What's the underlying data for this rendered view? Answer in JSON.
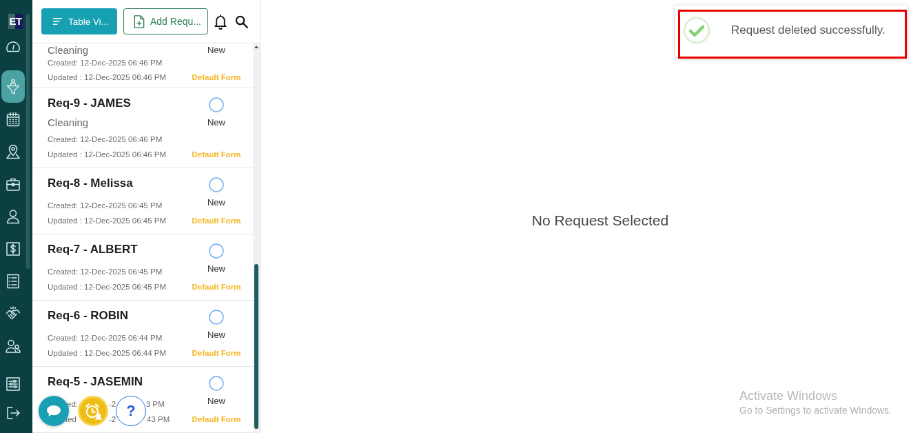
{
  "sidebar": {
    "logo": "ET",
    "items": [
      {
        "selected": false
      },
      {
        "selected": true
      },
      {
        "selected": false
      },
      {
        "selected": false
      },
      {
        "selected": false
      },
      {
        "selected": false
      },
      {
        "selected": false
      },
      {
        "selected": false
      },
      {
        "selected": false
      },
      {
        "selected": false
      }
    ],
    "bottom_items": [
      {
        "selected": false
      },
      {
        "selected": false
      }
    ]
  },
  "toolbar": {
    "view_button": "Table Vi...",
    "add_button": "Add Requ..."
  },
  "requests": [
    {
      "subtitle": "Cleaning",
      "status": "New",
      "created": "Created: 12-Dec-2025 06:46 PM",
      "updated": "Updated : 12-Dec-2025 06:46 PM",
      "form": "Default Form"
    },
    {
      "title": "Req-9 - JAMES",
      "subtitle": "Cleaning",
      "status": "New",
      "created": "Created: 12-Dec-2025 06:46 PM",
      "updated": "Updated : 12-Dec-2025 06:46 PM",
      "form": "Default Form"
    },
    {
      "title": "Req-8 - Melissa",
      "status": "New",
      "created": "Created: 12-Dec-2025 06:45 PM",
      "updated": "Updated : 12-Dec-2025 06:45 PM",
      "form": "Default Form"
    },
    {
      "title": "Req-7 - ALBERT",
      "status": "New",
      "created": "Created: 12-Dec-2025 06:45 PM",
      "updated": "Updated : 12-Dec-2025 06:45 PM",
      "form": "Default Form"
    },
    {
      "title": "Req-6 - ROBIN",
      "status": "New",
      "created": "Created: 12-Dec-2025 06:44 PM",
      "updated": "Updated : 12-Dec-2025 06:44 PM",
      "form": "Default Form"
    },
    {
      "title": "Req-5 - JASEMIN",
      "status": "New",
      "created_fragments": [
        "ed:",
        "-2",
        "3 PM"
      ],
      "updated_fragments": [
        "ted",
        "-2",
        "43 PM"
      ],
      "form": "Default Form"
    }
  ],
  "floating_buttons": {
    "help_label": "?"
  },
  "detail": {
    "empty_message": "No Request Selected"
  },
  "toast": {
    "message": "Request deleted successfully."
  },
  "os_notice": {
    "title": "Activate Windows",
    "text": "Go to Settings to activate Windows."
  }
}
